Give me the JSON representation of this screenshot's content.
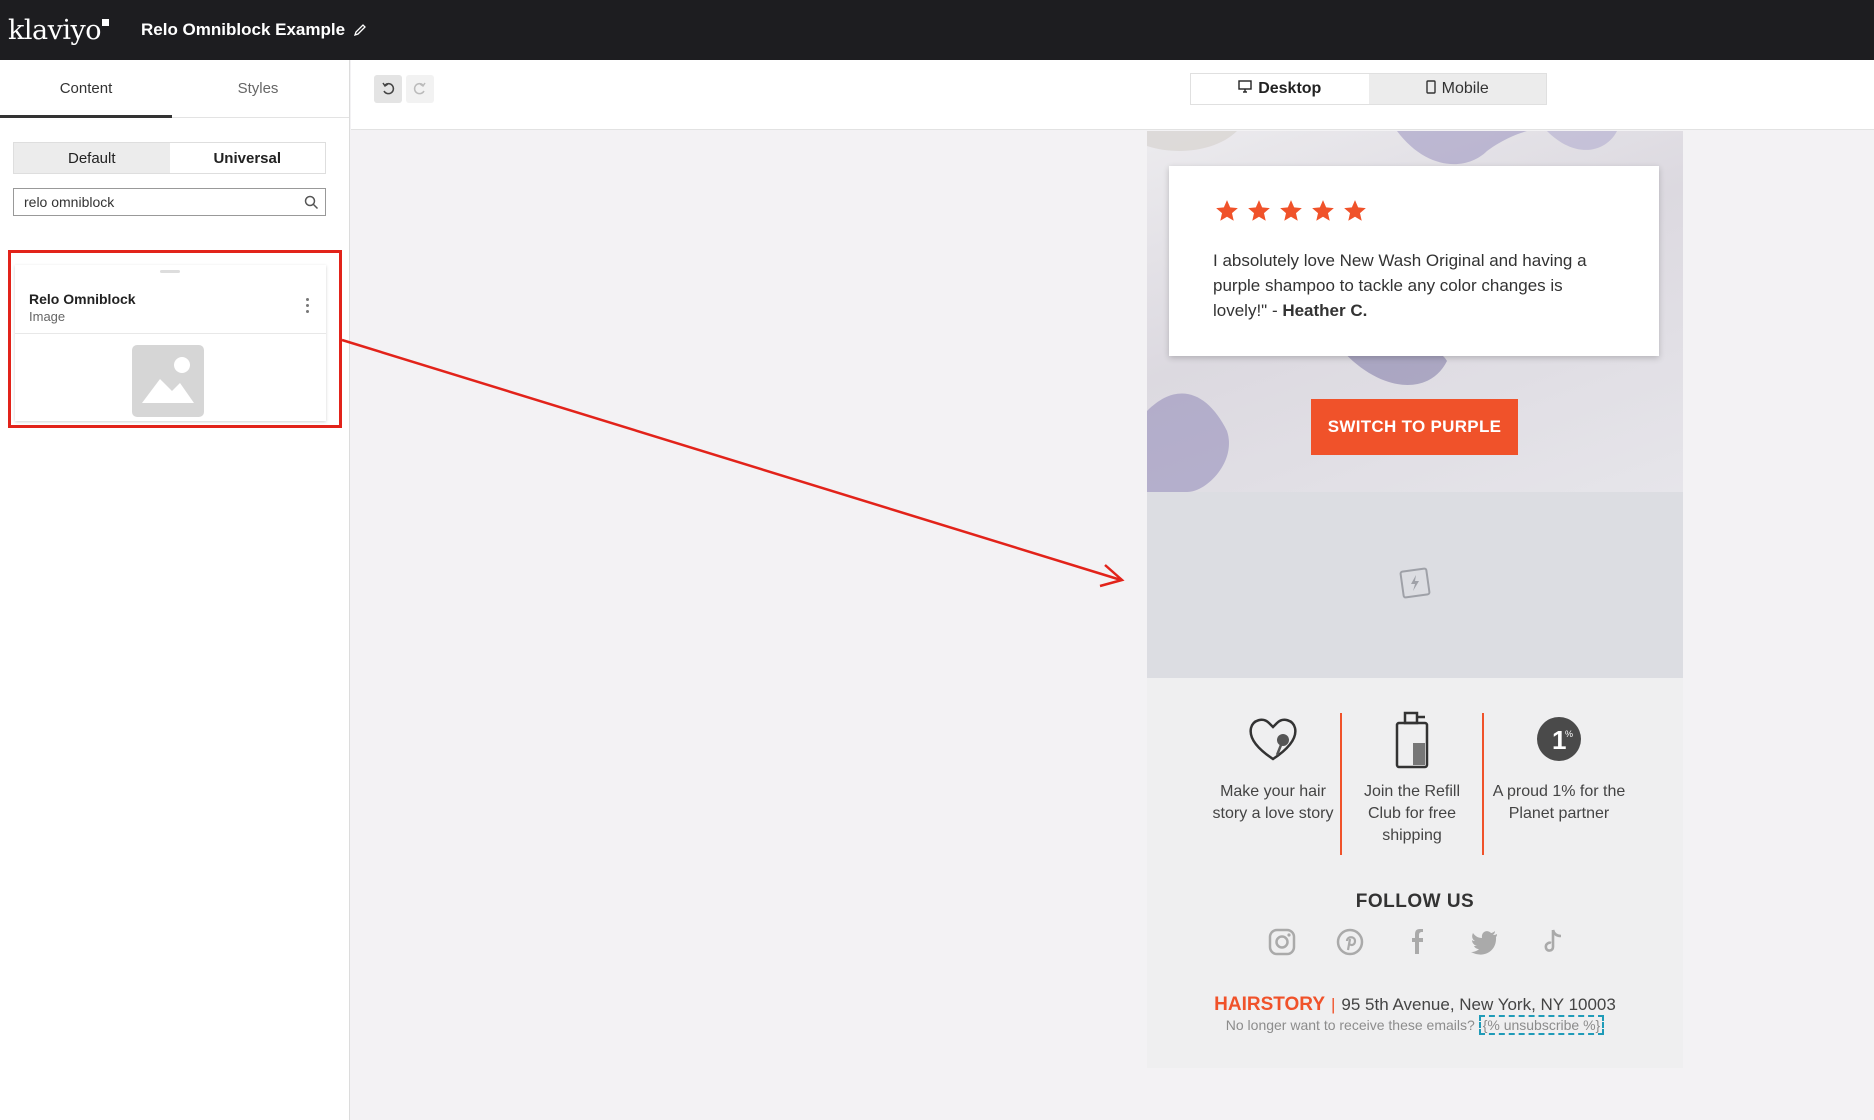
{
  "topbar": {
    "logo": "klaviyo",
    "title": "Relo Omniblock Example"
  },
  "panel": {
    "tabs": [
      "Content",
      "Styles"
    ],
    "toggle": [
      "Default",
      "Universal"
    ],
    "search_value": "relo omniblock",
    "block": {
      "title": "Relo Omniblock",
      "type": "Image"
    }
  },
  "canvas": {
    "devices": [
      "Desktop",
      "Mobile"
    ]
  },
  "email": {
    "review": {
      "stars": 5,
      "quote": "I absolutely love New Wash Original and having a purple shampoo to tackle any color changes is lovely!\" - ",
      "author": "Heather C."
    },
    "cta": "SWITCH TO PURPLE",
    "features": [
      "Make your hair story a love story",
      "Join the Refill Club for free shipping",
      "A proud 1% for the Planet partner"
    ],
    "follow": "FOLLOW US",
    "brand": "HAIRSTORY",
    "address": "95 5th Avenue, New York, NY 10003",
    "unsub_text": "No longer want to receive these emails?",
    "unsub_link": "{% unsubscribe %}"
  },
  "colors": {
    "accent": "#f0522a",
    "highlight": "#e2231a",
    "topbar": "#1d1d20"
  }
}
